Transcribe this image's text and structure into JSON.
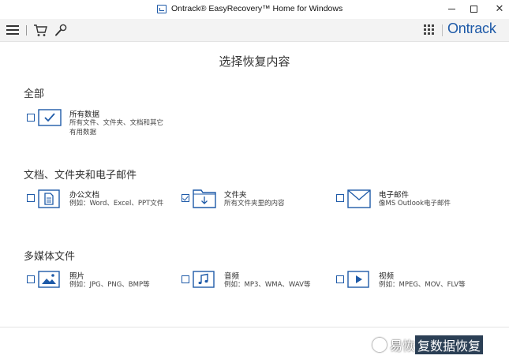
{
  "window": {
    "title": "Ontrack® EasyRecovery™ Home for Windows",
    "close_glyph": "✕"
  },
  "toolbar": {
    "brand": "Ontrack",
    "icons": [
      "menu-icon",
      "cart-icon",
      "wrench-icon",
      "apps-grid-icon"
    ]
  },
  "page": {
    "title": "选择恢复内容"
  },
  "sections": {
    "all": {
      "heading": "全部",
      "items": [
        {
          "title": "所有数据",
          "desc_line1": "所有文件、文件夹、文档和其它",
          "desc_line2": "有用数据",
          "checked": false,
          "icon": "checkmark-icon"
        }
      ]
    },
    "docs": {
      "heading": "文档、文件夹和电子邮件",
      "items": [
        {
          "title": "办公文档",
          "desc": "例如：Word、Excel、PPT文件",
          "checked": false,
          "icon": "document-icon"
        },
        {
          "title": "文件夹",
          "desc": "所有文件夹里的内容",
          "checked": true,
          "icon": "folder-icon"
        },
        {
          "title": "电子邮件",
          "desc": "像MS Outlook电子邮件",
          "checked": false,
          "icon": "envelope-icon"
        }
      ]
    },
    "media": {
      "heading": "多媒体文件",
      "items": [
        {
          "title": "照片",
          "desc": "例如：JPG、PNG、BMP等",
          "checked": false,
          "icon": "image-icon"
        },
        {
          "title": "音频",
          "desc": "例如：MP3、WMA、WAV等",
          "checked": false,
          "icon": "music-note-icon"
        },
        {
          "title": "视频",
          "desc": "例如：MPEG、MOV、FLV等",
          "checked": false,
          "icon": "video-play-icon"
        }
      ]
    }
  },
  "watermark": {
    "text_light": "易恢",
    "text_dark": "复数据恢复"
  },
  "colors": {
    "accent": "#1e5aa8",
    "toolbar_bg": "#f3f3f3",
    "page_bg": "#ffffff"
  }
}
